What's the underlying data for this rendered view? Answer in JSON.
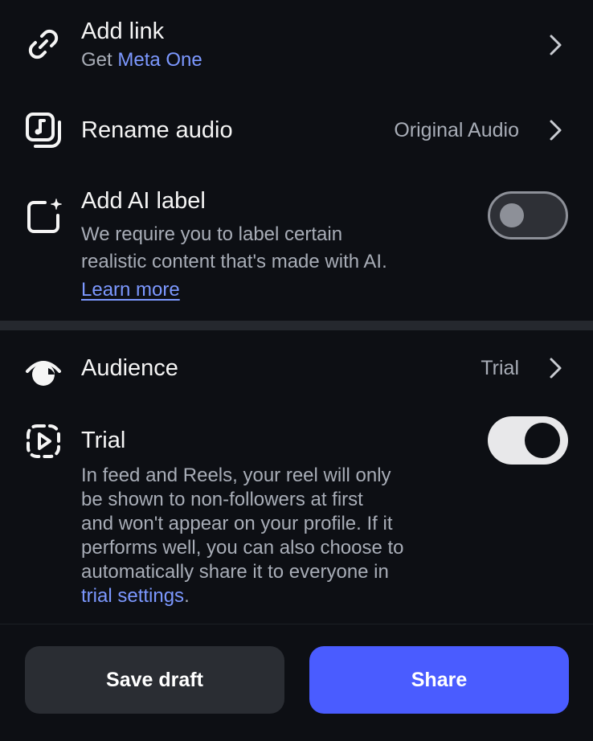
{
  "add_link": {
    "title": "Add link",
    "subtitle_prefix": "Get ",
    "subtitle_link": "Meta One",
    "icon": "link-icon"
  },
  "rename_audio": {
    "title": "Rename audio",
    "value": "Original Audio",
    "icon": "audio-note-icon"
  },
  "ai_label": {
    "title": "Add AI label",
    "desc_line1": "We require you to label certain",
    "desc_line2": "realistic content that's made with AI.",
    "learn_more": "Learn more",
    "toggle_on": false,
    "icon": "sparkle-square-icon"
  },
  "audience": {
    "title": "Audience",
    "value": "Trial",
    "icon": "eye-icon"
  },
  "trial": {
    "title": "Trial",
    "desc_lines": [
      "In feed and Reels, your reel will only",
      "be shown to non-followers at first",
      "and won't appear on your profile. If it",
      "performs well, you can also choose to",
      "automatically share it to everyone in"
    ],
    "desc_link": "trial settings",
    "desc_end": ".",
    "toggle_on": true,
    "icon": "dashed-play-icon"
  },
  "footer": {
    "save_draft": "Save draft",
    "share": "Share"
  },
  "colors": {
    "background": "#0d0f14",
    "accent": "#7c98ff",
    "share_button": "#4a5cff",
    "draft_button": "#2a2d33"
  }
}
